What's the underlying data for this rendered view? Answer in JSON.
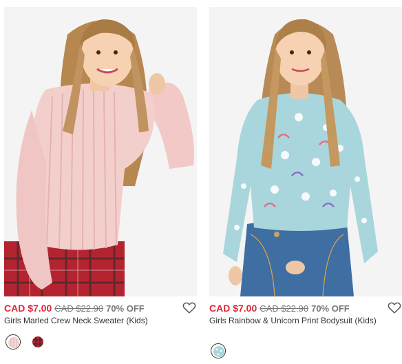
{
  "products": [
    {
      "sale_price": "CAD $7.00",
      "original_price": "CAD $22.90",
      "discount": "70% OFF",
      "name": "Girls Marled Crew Neck Sweater (Kids)",
      "swatches": [
        {
          "color_name": "pink",
          "color": "#f3d8d6",
          "selected": true
        },
        {
          "color_name": "red plaid",
          "color": "#b1242f",
          "selected": false
        }
      ],
      "accent": "#e2243a"
    },
    {
      "sale_price": "CAD $7.00",
      "original_price": "CAD $22.90",
      "discount": "70% OFF",
      "name": "Girls Rainbow & Unicorn Print Bodysuit (Kids)",
      "swatches": [
        {
          "color_name": "light blue",
          "color": "#a9d6dc",
          "selected": true
        }
      ],
      "accent": "#e2243a"
    }
  ],
  "icons": {
    "wishlist": "heart-outline-icon"
  }
}
